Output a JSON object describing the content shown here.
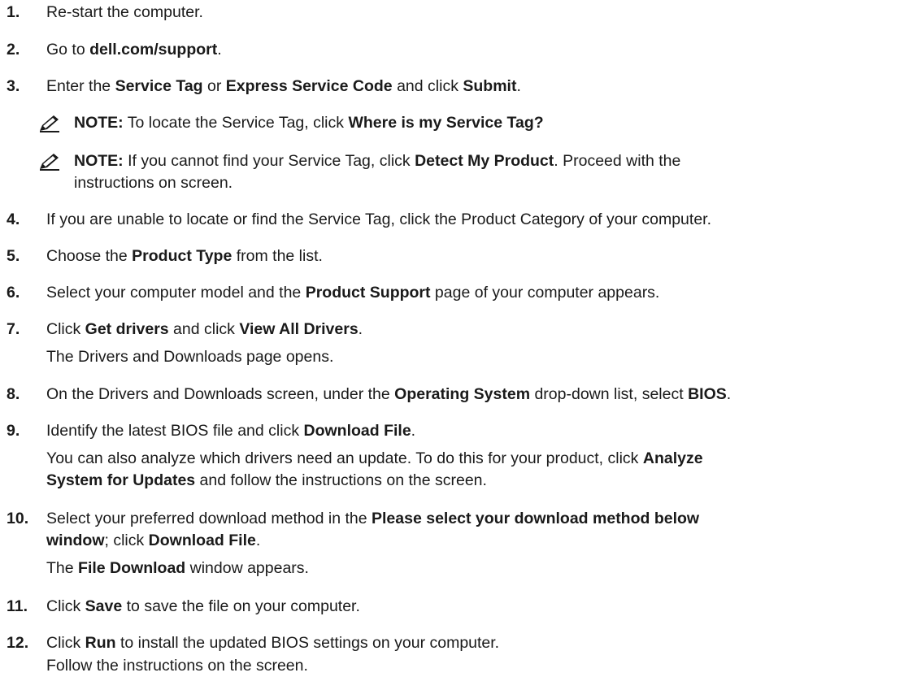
{
  "steps": [
    {
      "num": "1.",
      "segments": [
        {
          "t": "Re-start the computer."
        }
      ]
    },
    {
      "num": "2.",
      "segments": [
        {
          "t": "Go to "
        },
        {
          "t": "dell.com/support",
          "b": true
        },
        {
          "t": "."
        }
      ]
    },
    {
      "num": "3.",
      "segments": [
        {
          "t": "Enter the "
        },
        {
          "t": "Service Tag",
          "b": true
        },
        {
          "t": " or "
        },
        {
          "t": "Express Service Code",
          "b": true
        },
        {
          "t": " and click "
        },
        {
          "t": "Submit",
          "b": true
        },
        {
          "t": "."
        }
      ]
    },
    {
      "num": "4.",
      "segments": [
        {
          "t": "If you are unable to locate or find the Service Tag, click the Product Category of your computer."
        }
      ]
    },
    {
      "num": "5.",
      "segments": [
        {
          "t": "Choose the "
        },
        {
          "t": "Product Type",
          "b": true
        },
        {
          "t": " from the list."
        }
      ]
    },
    {
      "num": "6.",
      "segments": [
        {
          "t": "Select your computer model and the "
        },
        {
          "t": "Product Support",
          "b": true
        },
        {
          "t": " page of your computer appears."
        }
      ]
    },
    {
      "num": "7.",
      "segments": [
        {
          "t": "Click "
        },
        {
          "t": "Get drivers",
          "b": true
        },
        {
          "t": " and click "
        },
        {
          "t": "View All Drivers",
          "b": true
        },
        {
          "t": "."
        }
      ],
      "sub": "The Drivers and Downloads page opens."
    },
    {
      "num": "8.",
      "segments": [
        {
          "t": "On the Drivers and Downloads screen, under the "
        },
        {
          "t": "Operating System",
          "b": true
        },
        {
          "t": " drop-down list, select "
        },
        {
          "t": "BIOS",
          "b": true
        },
        {
          "t": "."
        }
      ]
    },
    {
      "num": "9.",
      "segments": [
        {
          "t": "Identify the latest BIOS file and click "
        },
        {
          "t": "Download File",
          "b": true
        },
        {
          "t": "."
        }
      ],
      "sub_lines": [
        [
          {
            "t": "You can also analyze which drivers need an update. To do this for your product, click "
          },
          {
            "t": "Analyze",
            "b": true
          }
        ],
        [
          {
            "t": "System for Updates",
            "b": true
          },
          {
            "t": " and follow the instructions on the screen."
          }
        ]
      ]
    },
    {
      "num": "10.",
      "lines": [
        [
          {
            "t": "Select your preferred download method in the "
          },
          {
            "t": "Please select your download method below",
            "b": true
          }
        ],
        [
          {
            "t": "window",
            "b": true
          },
          {
            "t": "; click "
          },
          {
            "t": "Download File",
            "b": true
          },
          {
            "t": "."
          }
        ]
      ],
      "sub_segments": [
        {
          "t": "The "
        },
        {
          "t": "File Download",
          "b": true
        },
        {
          "t": " window appears."
        }
      ]
    },
    {
      "num": "11.",
      "segments": [
        {
          "t": "Click "
        },
        {
          "t": "Save",
          "b": true
        },
        {
          "t": " to save the file on your computer."
        }
      ]
    },
    {
      "num": "12.",
      "segments": [
        {
          "t": "Click "
        },
        {
          "t": "Run",
          "b": true
        },
        {
          "t": " to install the updated BIOS settings on your computer."
        }
      ],
      "sub": "Follow the instructions on the screen."
    }
  ],
  "notes": [
    {
      "label": "NOTE:",
      "lines": [
        [
          {
            "t": " To locate the Service Tag, click "
          },
          {
            "t": "Where is my Service Tag?",
            "b": true
          }
        ]
      ]
    },
    {
      "label": "NOTE:",
      "lines": [
        [
          {
            "t": " If you cannot find your Service Tag, click "
          },
          {
            "t": "Detect My Product",
            "b": true
          },
          {
            "t": ". Proceed with the"
          }
        ],
        [
          {
            "t": "instructions on screen."
          }
        ]
      ]
    }
  ]
}
